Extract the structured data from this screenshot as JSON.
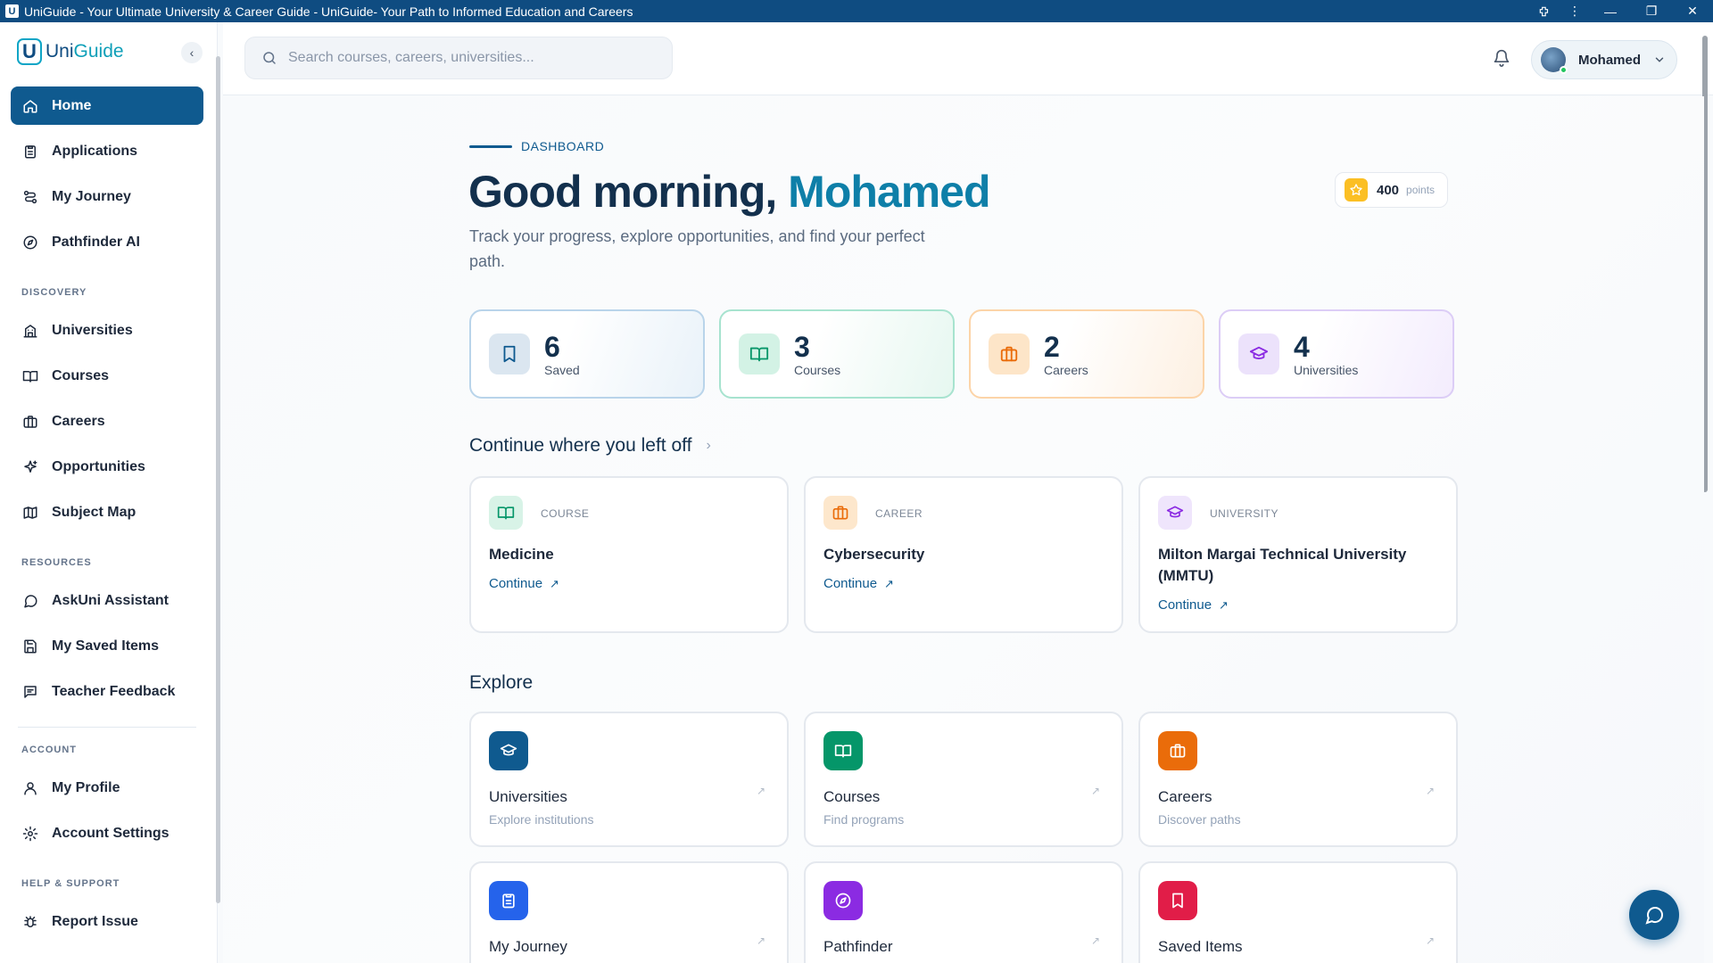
{
  "window": {
    "title": "UniGuide - Your Ultimate University & Career Guide - UniGuide- Your Path to Informed Education and Careers"
  },
  "brand": {
    "name_a": "Uni",
    "name_b": "Guide"
  },
  "sidebar": {
    "main_items": [
      {
        "label": "Home",
        "icon": "home-icon",
        "active": true
      },
      {
        "label": "Applications",
        "icon": "clipboard-icon"
      },
      {
        "label": "My Journey",
        "icon": "route-icon"
      },
      {
        "label": "Pathfinder AI",
        "icon": "compass-icon"
      }
    ],
    "discovery_label": "DISCOVERY",
    "discovery_items": [
      {
        "label": "Universities",
        "icon": "building-icon"
      },
      {
        "label": "Courses",
        "icon": "book-icon"
      },
      {
        "label": "Careers",
        "icon": "briefcase-icon"
      },
      {
        "label": "Opportunities",
        "icon": "sparkle-icon"
      },
      {
        "label": "Subject Map",
        "icon": "map-icon"
      }
    ],
    "resources_label": "RESOURCES",
    "resources_items": [
      {
        "label": "AskUni Assistant",
        "icon": "chat-icon"
      },
      {
        "label": "My Saved Items",
        "icon": "save-icon"
      },
      {
        "label": "Teacher Feedback",
        "icon": "feedback-icon"
      }
    ],
    "account_label": "ACCOUNT",
    "account_items": [
      {
        "label": "My Profile",
        "icon": "user-icon"
      },
      {
        "label": "Account Settings",
        "icon": "gear-icon"
      }
    ],
    "help_label": "HELP & SUPPORT",
    "help_items": [
      {
        "label": "Report Issue",
        "icon": "bug-icon"
      }
    ]
  },
  "header": {
    "search_placeholder": "Search courses, careers, universities...",
    "user_name": "Mohamed"
  },
  "dashboard": {
    "eyebrow": "DASHBOARD",
    "greeting_prefix": "Good morning, ",
    "greeting_name": "Mohamed",
    "subtitle": "Track your progress, explore opportunities, and find your perfect path.",
    "points_value": "400",
    "points_label": "points",
    "stats": [
      {
        "value": "6",
        "label": "Saved",
        "icon": "bookmark-icon"
      },
      {
        "value": "3",
        "label": "Courses",
        "icon": "book-icon"
      },
      {
        "value": "2",
        "label": "Careers",
        "icon": "briefcase-icon"
      },
      {
        "value": "4",
        "label": "Universities",
        "icon": "graduation-cap-icon"
      }
    ],
    "continue_heading": "Continue where you left off",
    "continue_cards": [
      {
        "type": "COURSE",
        "title": "Medicine",
        "link": "Continue"
      },
      {
        "type": "CAREER",
        "title": "Cybersecurity",
        "link": "Continue"
      },
      {
        "type": "UNIVERSITY",
        "title": "Milton Margai Technical University (MMTU)",
        "link": "Continue"
      }
    ],
    "explore_heading": "Explore",
    "explore_cards": [
      {
        "title": "Universities",
        "subtitle": "Explore institutions",
        "color": "#0f5a8f",
        "icon": "graduation-cap-icon"
      },
      {
        "title": "Courses",
        "subtitle": "Find programs",
        "color": "#059669",
        "icon": "book-icon"
      },
      {
        "title": "Careers",
        "subtitle": "Discover paths",
        "color": "#ea6c0a",
        "icon": "briefcase-icon"
      },
      {
        "title": "My Journey",
        "subtitle": "",
        "color": "#2563eb",
        "icon": "clipboard-icon"
      },
      {
        "title": "Pathfinder",
        "subtitle": "",
        "color": "#8b2be2",
        "icon": "compass-icon"
      },
      {
        "title": "Saved Items",
        "subtitle": "",
        "color": "#e11d48",
        "icon": "bookmark-icon"
      }
    ]
  }
}
